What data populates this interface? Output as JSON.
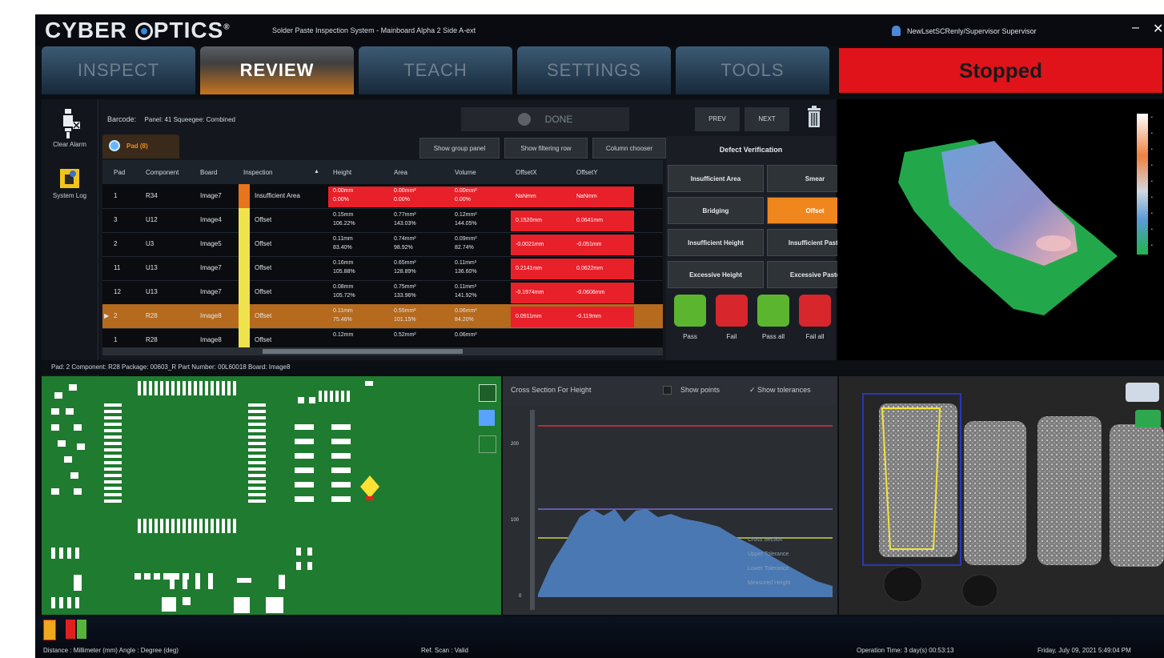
{
  "app": {
    "logo": "CYBER OPTICS",
    "subtitle": "Solder Paste Inspection System  -  Mainboard Alpha 2 Side A-ext",
    "user": "NewLsetSCRenly/Supervisor    Supervisor",
    "minimize": "–",
    "close": "✕"
  },
  "tabs": [
    {
      "label": "INSPECT"
    },
    {
      "label": "REVIEW"
    },
    {
      "label": "TEACH"
    },
    {
      "label": "SETTINGS"
    },
    {
      "label": "TOOLS"
    }
  ],
  "status": {
    "text": "Stopped",
    "color": "#e0131b"
  },
  "sidebar": [
    {
      "label": "Clear Alarm",
      "icon": "clear-alarm-icon"
    },
    {
      "label": "System Log",
      "icon": "system-log-icon"
    }
  ],
  "review": {
    "barcode_label": "Barcode:",
    "barcode_info": "Panel: 41   Squeegee: Combined",
    "done_label": "DONE",
    "prev_label": "PREV",
    "next_label": "NEXT",
    "pad_tab_label": "Pad (8)",
    "buttons": {
      "show_group_panel": "Show group panel",
      "show_filtering_row": "Show filtering row",
      "column_chooser": "Column chooser"
    },
    "columns": [
      "Pad",
      "Component",
      "Board",
      "Inspection",
      "Height",
      "Area",
      "Volume",
      "OffsetX",
      "OffsetY"
    ],
    "rows": [
      {
        "pad": "1",
        "component": "R34",
        "board": "Image7",
        "inspection": "Insufficient Area",
        "height": "0.00mm\n0.00%",
        "area": "0.00mm²\n0.00%",
        "volume": "0.00mm³\n0.00%",
        "offx": "NaNmm",
        "offy": "NaNmm",
        "swatch": "#e8741c"
      },
      {
        "pad": "3",
        "component": "U12",
        "board": "Image4",
        "inspection": "Offset",
        "height": "0.15mm\n106.22%",
        "area": "0.77mm²\n143.03%",
        "volume": "0.12mm³\n144.05%",
        "offx": "0.1520mm",
        "offy": "0.0641mm",
        "swatch": "#efe34d"
      },
      {
        "pad": "2",
        "component": "U3",
        "board": "Image5",
        "inspection": "Offset",
        "height": "0.11mm\n83.40%",
        "area": "0.74mm²\n98.92%",
        "volume": "0.09mm³\n82.74%",
        "offx": "-0.0021mm",
        "offy": "-0.051mm",
        "swatch": "#efe34d"
      },
      {
        "pad": "11",
        "component": "U13",
        "board": "Image7",
        "inspection": "Offset",
        "height": "0.16mm\n105.88%",
        "area": "0.65mm²\n128.89%",
        "volume": "0.11mm³\n136.60%",
        "offx": "0.2141mm",
        "offy": "0.0622mm",
        "swatch": "#efe34d"
      },
      {
        "pad": "12",
        "component": "U13",
        "board": "Image7",
        "inspection": "Offset",
        "height": "0.08mm\n105.72%",
        "area": "0.75mm²\n133.96%",
        "volume": "0.11mm³\n141.92%",
        "offx": "-0.1974mm",
        "offy": "-0.0606mm",
        "swatch": "#efe34d"
      },
      {
        "pad": "2",
        "component": "R28",
        "board": "Image8",
        "inspection": "Offset",
        "height": "0.11mm\n75.46%",
        "area": "0.55mm²\n101.15%",
        "volume": "0.06mm³\n84.20%",
        "offx": "0.0911mm",
        "offy": "-0.119mm",
        "swatch": "#efe34d"
      },
      {
        "pad": "1",
        "component": "R28",
        "board": "Image8",
        "inspection": "Offset",
        "height": "0.12mm",
        "area": "0.52mm²",
        "volume": "0.06mm³",
        "offx": "",
        "offy": "",
        "swatch": "#efe34d"
      }
    ],
    "selected_row": 5,
    "defect_title": "Defect Verification",
    "defect_buttons": [
      "Insufficient Area",
      "Smear",
      "Bridging",
      "Offset",
      "Insufficient Height",
      "Insufficient Paste",
      "Excessive Height",
      "Excessive Paste"
    ],
    "defect_active": "Offset",
    "actions": [
      {
        "label": "Pass",
        "icon": "thumbs-up-icon",
        "color": "#5cb52f"
      },
      {
        "label": "Fail",
        "icon": "thumbs-down-icon",
        "color": "#d7262c"
      },
      {
        "label": "Pass all",
        "icon": "thumbs-up-all-icon",
        "color": "#5cb52f"
      },
      {
        "label": "Fail all",
        "icon": "thumbs-down-all-icon",
        "color": "#d7262c"
      }
    ]
  },
  "info_bar": "Pad: 2    Component: R28    Package: 00603_R    Part Number: 00L60018    Board: Image8",
  "cross_section": {
    "title": "Cross Section For Height",
    "show_points": "Show points",
    "show_tolerances": "✓ Show tolerances",
    "ticks": [
      "200",
      "100",
      "0"
    ],
    "legend": [
      "Cross Section",
      "Upper Tolerance",
      "Lower Tolerance",
      "Measured Height"
    ]
  },
  "bottom": {
    "units": "Distance : Millimeter (mm)    Angle : Degree (deg)",
    "ref_scan": "Ref. Scan : Valid",
    "op_time": "Operation Time: 3 day(s) 00:53:13",
    "date": "Friday, July 09, 2021   5:49:04 PM"
  }
}
